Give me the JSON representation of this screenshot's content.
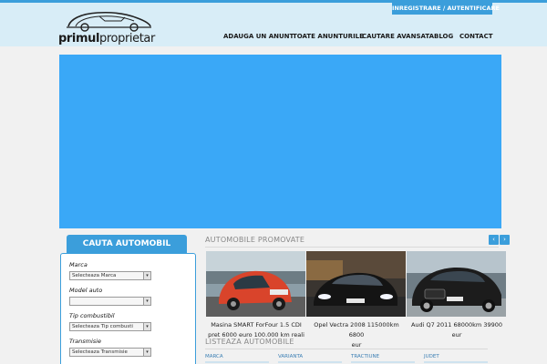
{
  "brand": {
    "logo_bold": "primul",
    "logo_rest": "proprietar"
  },
  "header": {
    "login_link": "INREGISTRARE / AUTENTIFICARE"
  },
  "nav": [
    {
      "label": "ADAUGA UN ANUNT"
    },
    {
      "label": "TOATE ANUNTURILE"
    },
    {
      "label": "CAUTARE AVANSATA"
    },
    {
      "label": "BLOG"
    },
    {
      "label": "CONTACT"
    }
  ],
  "search": {
    "title": "CAUTA AUTOMOBIL",
    "fields": [
      {
        "label": "Marca",
        "value": "Selecteaza Marca"
      },
      {
        "label": "Model auto",
        "value": ""
      },
      {
        "label": "Tip combustibil",
        "value": "Selecteaza Tip combusti"
      },
      {
        "label": "Transmisie",
        "value": "Selecteaza Transmisie"
      }
    ]
  },
  "promoted": {
    "title": "AUTOMOBILE PROMOVATE",
    "prev_icon": "chevron-left-icon",
    "next_icon": "chevron-right-icon",
    "cars": [
      {
        "caption_line1": "Masina SMART ForFour 1.5 CDI",
        "caption_line2": "pret 6000 euro 100.000 km reali",
        "color": "#d9442b"
      },
      {
        "caption_line1": "Opel Vectra 2008 115000km 6800",
        "caption_line2": "eur",
        "color": "#1b1b1b"
      },
      {
        "caption_line1": "Audi Q7 2011 68000km 39900 eur",
        "caption_line2": "",
        "color": "#1f1f1f"
      }
    ]
  },
  "listing": {
    "title": "LISTEAZA AUTOMOBILE",
    "columns": [
      "MARCA",
      "VARIANTA",
      "TRACTIUNE",
      "JUDET"
    ]
  },
  "colors": {
    "accent": "#3b9edb",
    "banner": "#3aa8f7",
    "header_bg": "#d8edf7"
  }
}
